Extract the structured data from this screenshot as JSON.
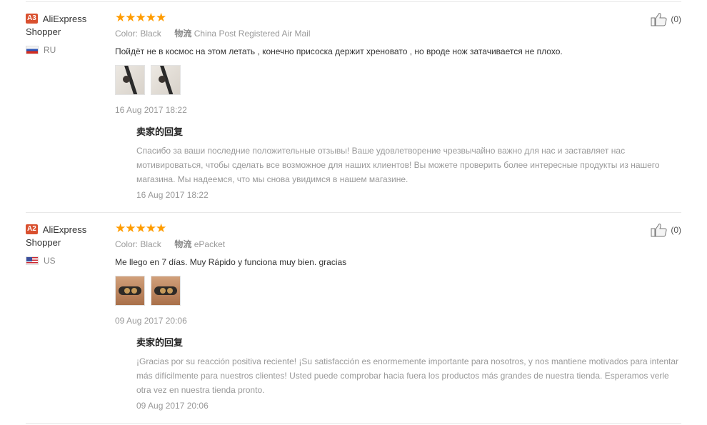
{
  "reviews": [
    {
      "level_badge": "A3",
      "user_name_line1": "AliExpress",
      "user_name_line2": "Shopper",
      "country": "RU",
      "stars": "★★★★★",
      "color_key": "Color:",
      "color_value": "Black",
      "logistics_key": "物流",
      "logistics_value": "China Post Registered Air Mail",
      "text": "Пойдёт не в космос на этом летать , конечно присоска держит хреновато , но вроде нож затачивается не плохо.",
      "date": "16 Aug 2017 18:22",
      "reply_title": "卖家的回复",
      "reply_text": "Спасибо за ваши последние положительные отзывы! Ваше удовлетворение чрезвычайно важно для нас и заставляет нас мотивироваться, чтобы сделать все возможное для наших клиентов! Вы можете проверить более интересные продукты из нашего магазина. Мы надеемся, что мы снова увидимся в нашем магазине.",
      "reply_date": "16 Aug 2017 18:22",
      "likes": "(0)"
    },
    {
      "level_badge": "A2",
      "user_name_line1": "AliExpress",
      "user_name_line2": "Shopper",
      "country": "US",
      "stars": "★★★★★",
      "color_key": "Color:",
      "color_value": "Black",
      "logistics_key": "物流",
      "logistics_value": "ePacket",
      "text": "Me llego en 7 días. Muy Rápido y funciona muy bien. gracias",
      "date": "09 Aug 2017 20:06",
      "reply_title": "卖家的回复",
      "reply_text": "¡Gracias por su reacción positiva reciente! ¡Su satisfacción es enormemente importante para nosotros, y nos mantiene motivados para intentar más difícilmente para nuestros clientes! Usted puede comprobar hacia fuera los productos más grandes de nuestra tienda. Esperamos verle otra vez en nuestra tienda pronto.",
      "reply_date": "09 Aug 2017 20:06",
      "likes": "(0)"
    }
  ],
  "colors": {
    "badge": "#d9502f",
    "stars": "#ff9c00",
    "muted": "#999999",
    "divider": "#e8e8e8"
  },
  "icons": [
    "thumbs-up-icon",
    "star-icon",
    "flag-ru-icon",
    "flag-us-icon"
  ]
}
